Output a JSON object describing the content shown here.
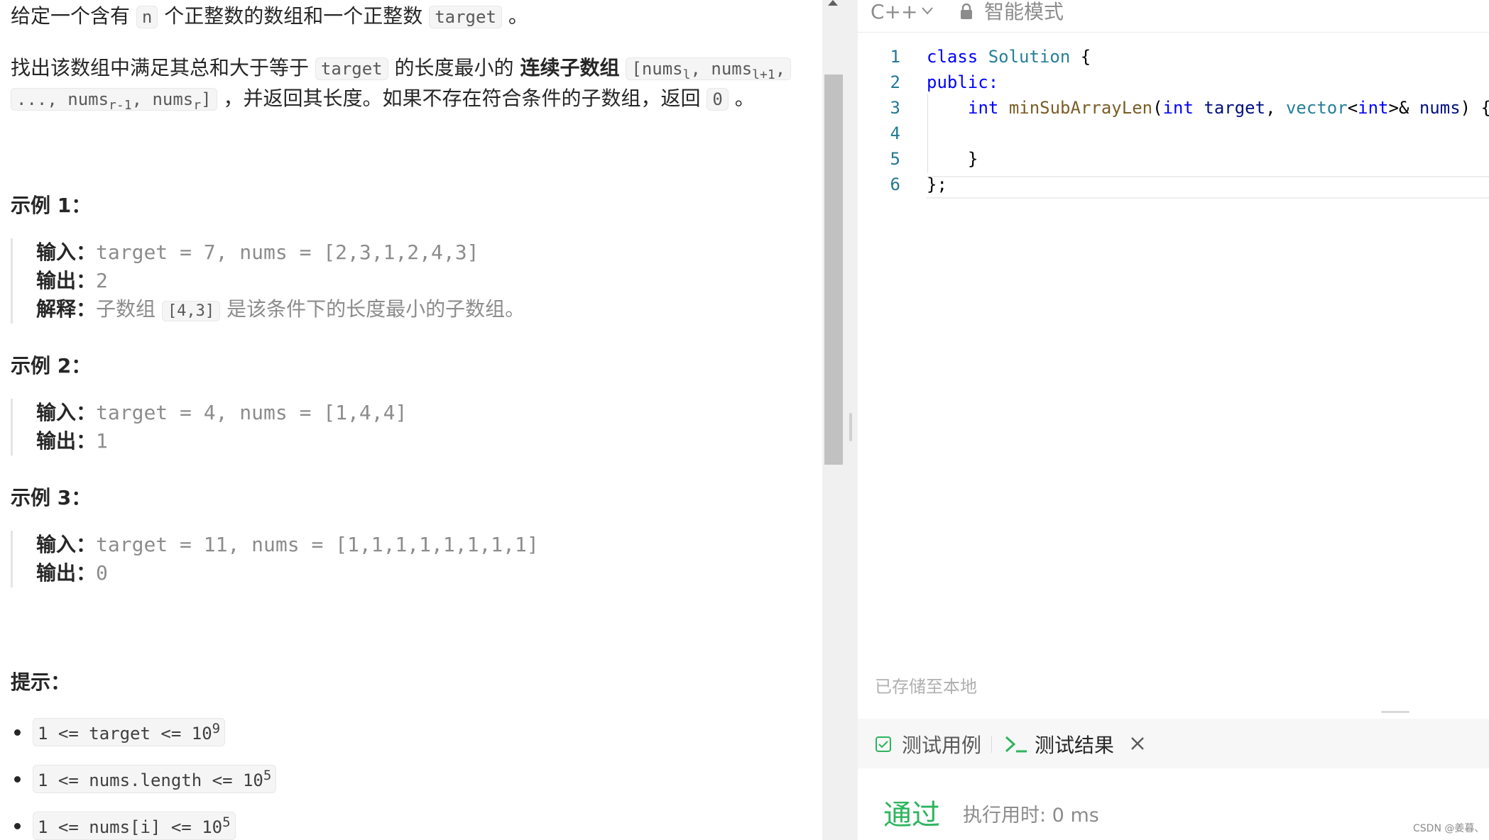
{
  "problem": {
    "line1": {
      "a": "给定一个含有",
      "code_n": "n",
      "b": "个正整数的数组和一个正整数",
      "code_target": "target",
      "c": "。"
    },
    "line2": {
      "a": "找出该数组中满足其总和大于等于",
      "code_target": "target",
      "b": "的长度最小的",
      "bold": "连续子数组",
      "code_sub1": "[nums",
      "sub_l": "l",
      "comma1": ", nums",
      "sub_l1": "l+1",
      "comma2": ","
    },
    "line3": {
      "code_a": "..., nums",
      "sub_r1": "r-1",
      "code_b": ", nums",
      "sub_r": "r",
      "code_c": "]",
      "text": "，并返回其长度。如果不存在符合条件的子数组，返回",
      "code_zero": "0",
      "end": "。"
    }
  },
  "examples": [
    {
      "title": "示例 1：",
      "rows": [
        {
          "label": "输入：",
          "value": "target = 7, nums = [2,3,1,2,4,3]"
        },
        {
          "label": "输出：",
          "value": "2"
        },
        {
          "label": "解释：",
          "text_a": "子数组",
          "code": "[4,3]",
          "text_b": "是该条件下的长度最小的子数组。"
        }
      ]
    },
    {
      "title": "示例 2：",
      "rows": [
        {
          "label": "输入：",
          "value": "target = 4, nums = [1,4,4]"
        },
        {
          "label": "输出：",
          "value": "1"
        }
      ]
    },
    {
      "title": "示例 3：",
      "rows": [
        {
          "label": "输入：",
          "value": "target = 11, nums = [1,1,1,1,1,1,1,1]"
        },
        {
          "label": "输出：",
          "value": "0"
        }
      ]
    }
  ],
  "hints": {
    "title": "提示：",
    "items": [
      {
        "code": "1 <= target <= 10",
        "sup": "9"
      },
      {
        "code": "1 <= nums.length <= 10",
        "sup": "5"
      },
      {
        "code": "1 <= nums[i] <= 10",
        "sup": "5"
      }
    ]
  },
  "editor": {
    "language": "C++",
    "mode": "智能模式",
    "saved_status": "已存储至本地",
    "line_numbers": [
      "1",
      "2",
      "3",
      "4",
      "5",
      "6"
    ],
    "code": {
      "l1": {
        "kw": "class",
        "ty": "Solution",
        "rest": " {"
      },
      "l2": {
        "kw": "public:"
      },
      "l3": {
        "kw1": "int",
        "fn": "minSubArrayLen",
        "p1": "(",
        "kw2": "int",
        "pm1": "target",
        "p2": ", ",
        "ty": "vector",
        "lt": "<",
        "kw3": "int",
        "gt": ">& ",
        "pm2": "nums",
        "p3": ") {"
      },
      "l5": "}",
      "l6": "};"
    }
  },
  "console": {
    "tab_testcase": "测试用例",
    "tab_result": "测试结果",
    "status": "通过",
    "runtime": "执行用时: 0 ms"
  },
  "watermark": "CSDN @姜暮、",
  "colors": {
    "pass": "#2db55d",
    "keyword": "#0000ff",
    "type": "#267f99",
    "function": "#795e26",
    "param": "#001080",
    "line_number": "#237893"
  }
}
